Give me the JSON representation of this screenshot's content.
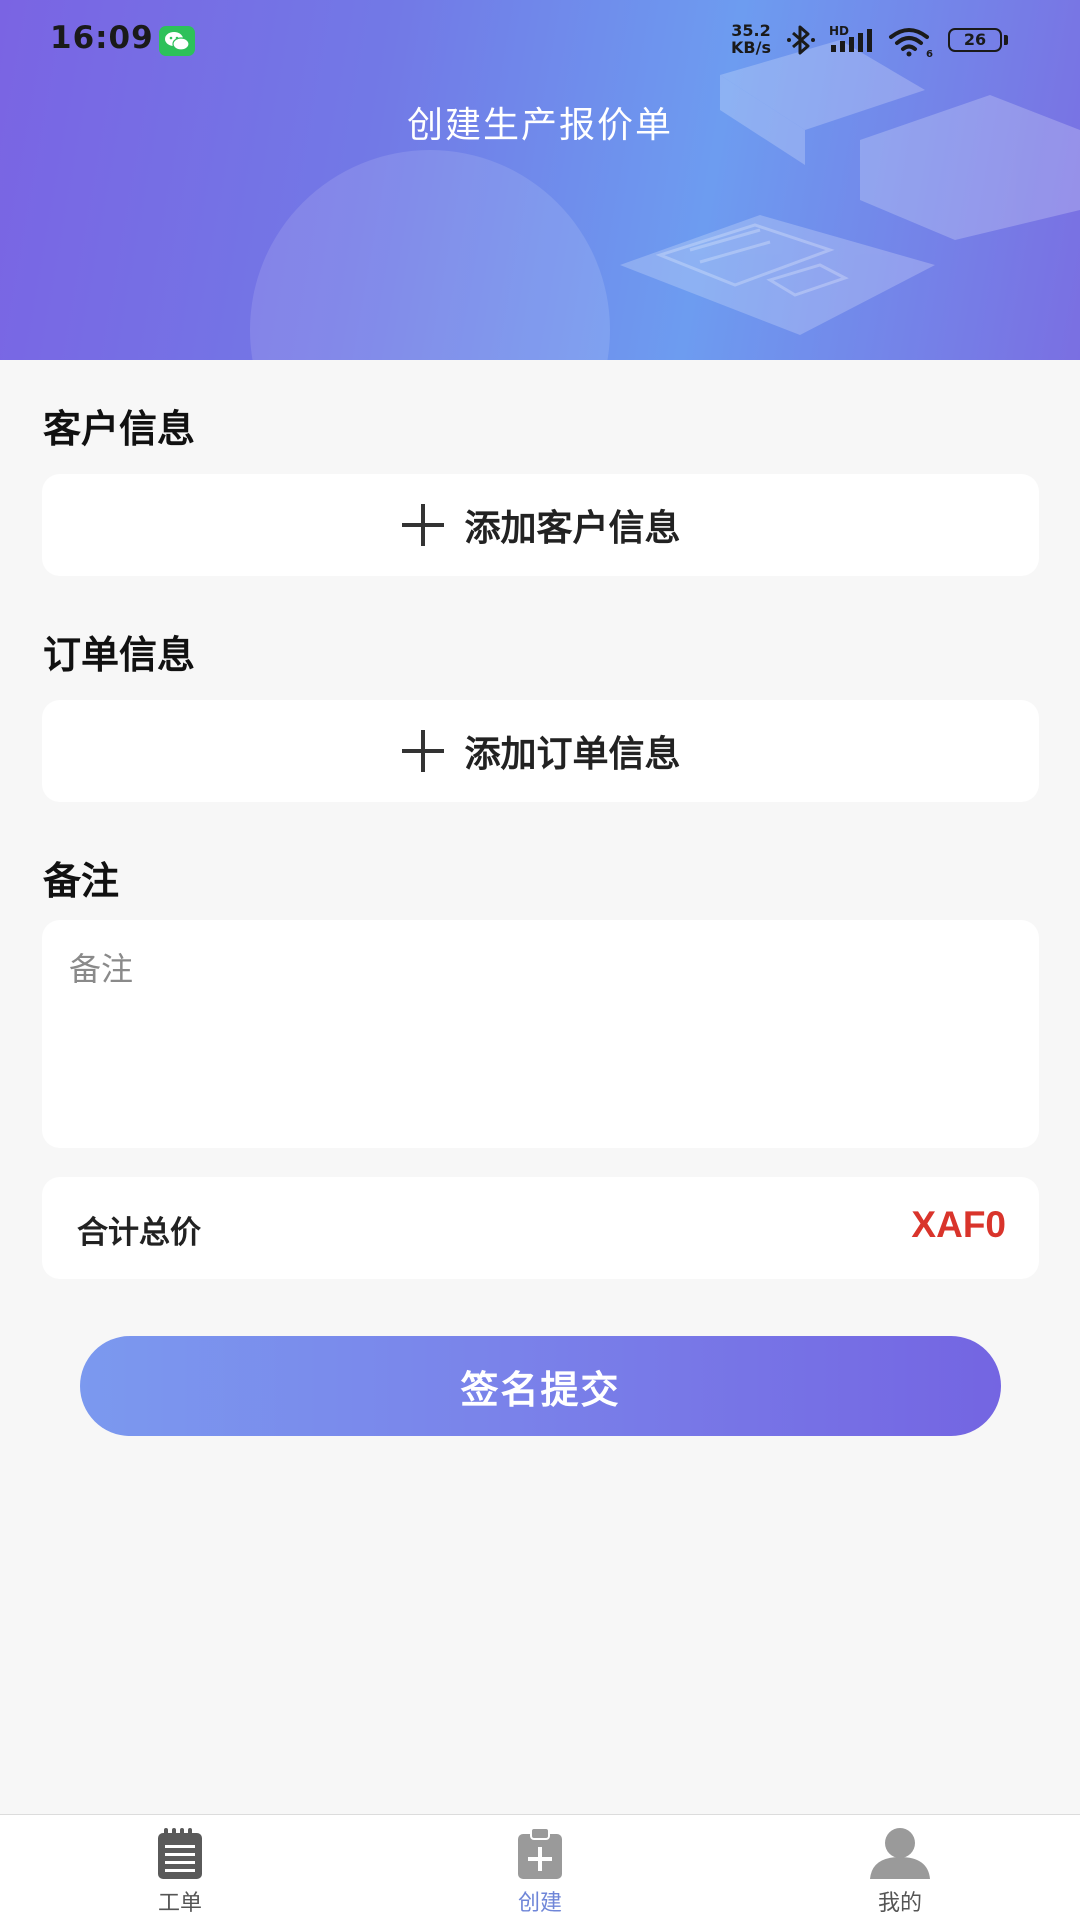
{
  "status_bar": {
    "time": "16:09",
    "network_speed_value": "35.2",
    "network_speed_unit": "KB/s",
    "hd_label": "HD",
    "battery": "26",
    "icons": [
      "wechat-icon",
      "bluetooth-icon",
      "signal-icon",
      "wifi-icon",
      "battery-icon"
    ]
  },
  "header": {
    "title": "创建生产报价单"
  },
  "customer": {
    "section_title": "客户信息",
    "add_label": "添加客户信息"
  },
  "order": {
    "section_title": "订单信息",
    "add_label": "添加订单信息"
  },
  "remark": {
    "section_title": "备注",
    "placeholder": "备注",
    "value": ""
  },
  "total": {
    "label": "合计总价",
    "value": "XAF0"
  },
  "submit": {
    "label": "签名提交"
  },
  "tabbar": {
    "tabs": [
      {
        "label": "工单",
        "icon": "notepad-icon",
        "active": false
      },
      {
        "label": "创建",
        "icon": "clipboard-plus-icon",
        "active": true
      },
      {
        "label": "我的",
        "icon": "user-icon",
        "active": false
      }
    ]
  },
  "colors": {
    "accent": "#7465e2",
    "tab_active": "#6f86d8",
    "total_value": "#d9342b",
    "background": "#f7f7f7"
  }
}
